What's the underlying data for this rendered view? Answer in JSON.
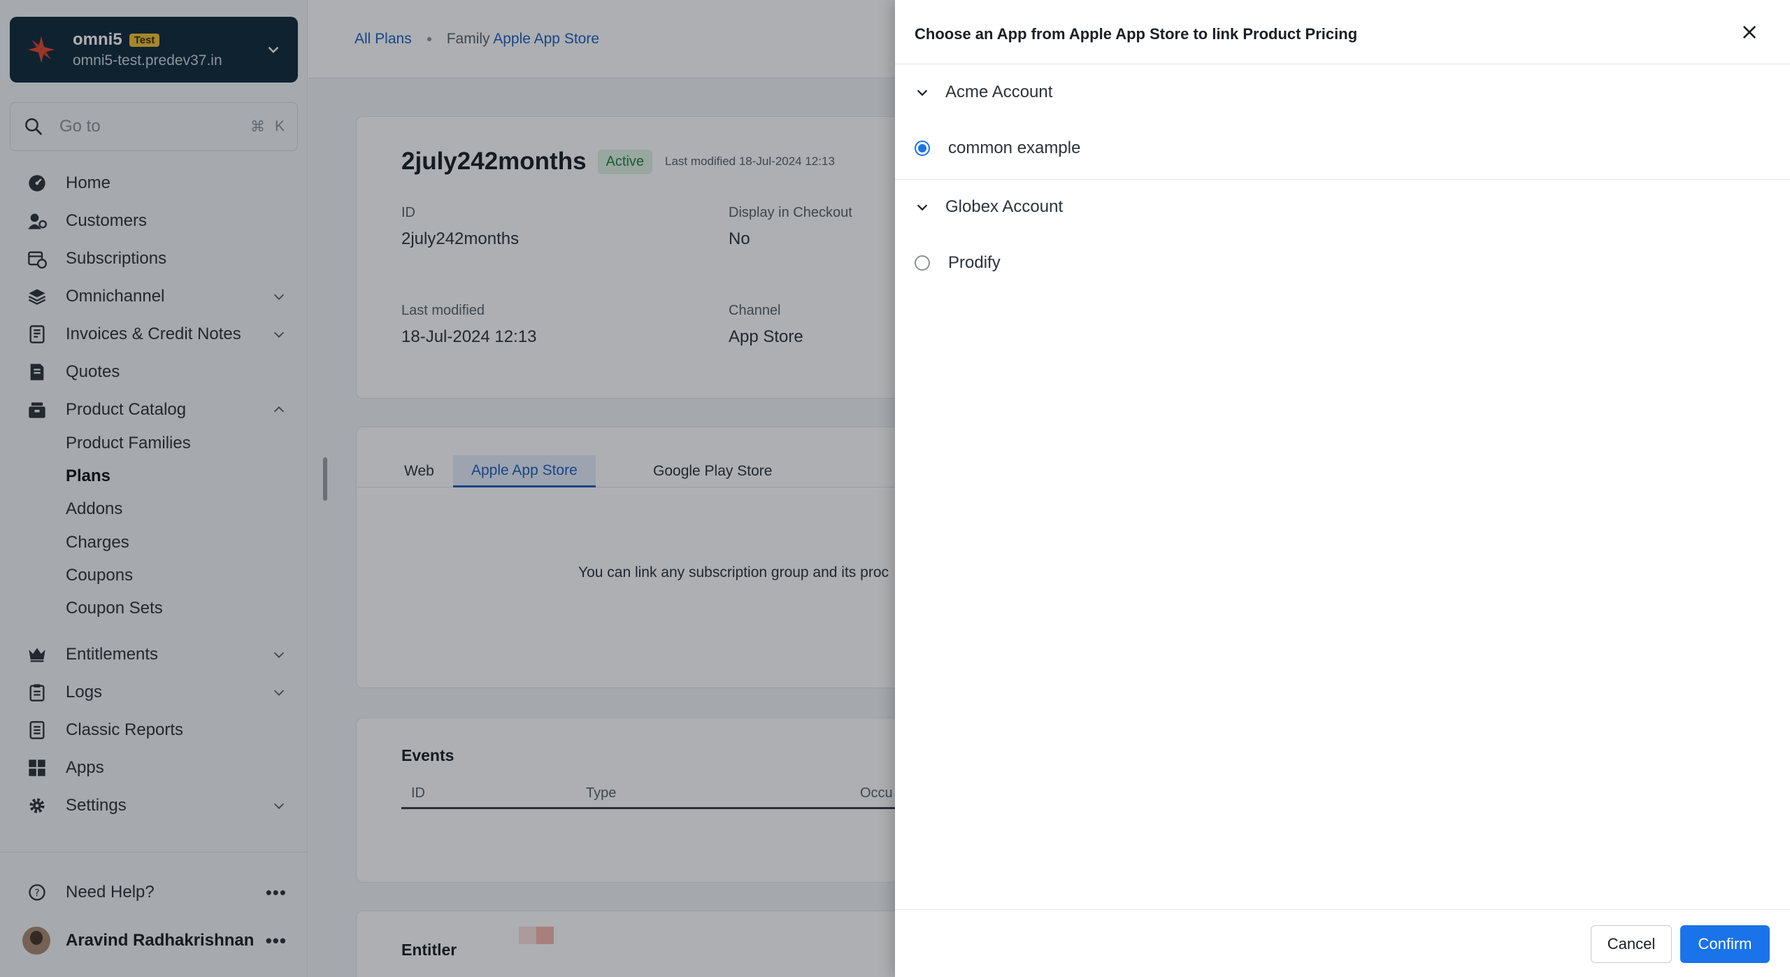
{
  "site": {
    "name": "omni5",
    "badge": "Test",
    "domain": "omni5-test.predev37.in"
  },
  "goto": {
    "placeholder": "Go to",
    "shortcut_mod": "⌘",
    "shortcut_key": "K"
  },
  "nav": {
    "home": "Home",
    "customers": "Customers",
    "subscriptions": "Subscriptions",
    "omnichannel": "Omnichannel",
    "invoices": "Invoices & Credit Notes",
    "quotes": "Quotes",
    "product_catalog": "Product Catalog",
    "product_catalog_children": [
      "Product Families",
      "Plans",
      "Addons",
      "Charges",
      "Coupons",
      "Coupon Sets"
    ],
    "entitlements": "Entitlements",
    "logs": "Logs",
    "classic_reports": "Classic Reports",
    "apps": "Apps",
    "settings": "Settings",
    "need_help": "Need Help?",
    "user": "Aravind Radhakrishnan"
  },
  "breadcrumb": {
    "all_plans": "All Plans",
    "family_label": "Family",
    "family_value": "Apple App Store"
  },
  "plan": {
    "title": "2july242months",
    "status": "Active",
    "last_modified_short": "Last modified 18-Jul-2024 12:13",
    "fields": {
      "id_label": "ID",
      "id_value": "2july242months",
      "display_label": "Display in Checkout",
      "display_value": "No",
      "last_mod_label": "Last modified",
      "last_mod_value": "18-Jul-2024 12:13",
      "channel_label": "Channel",
      "channel_value": "App Store"
    }
  },
  "tabs": {
    "items": [
      "Web",
      "Apple App Store",
      "Google Play Store"
    ],
    "active": "Apple App Store",
    "body_text": "You can link any subscription group and its proc"
  },
  "events": {
    "title": "Events",
    "columns": [
      "ID",
      "Type",
      "Occu"
    ]
  },
  "entitlements_card": {
    "title": "Entitler"
  },
  "drawer": {
    "title": "Choose an App from Apple App Store to link Product Pricing",
    "groups": [
      {
        "name": "Acme Account",
        "apps": [
          {
            "name": "common example",
            "selected": true
          }
        ]
      },
      {
        "name": "Globex Account",
        "apps": [
          {
            "name": "Prodify",
            "selected": false
          }
        ]
      }
    ],
    "cancel_label": "Cancel",
    "confirm_label": "Confirm"
  },
  "colors": {
    "accent": "#1a73e8",
    "sidebar_header": "#102a3b",
    "status_green": "#23803f"
  }
}
